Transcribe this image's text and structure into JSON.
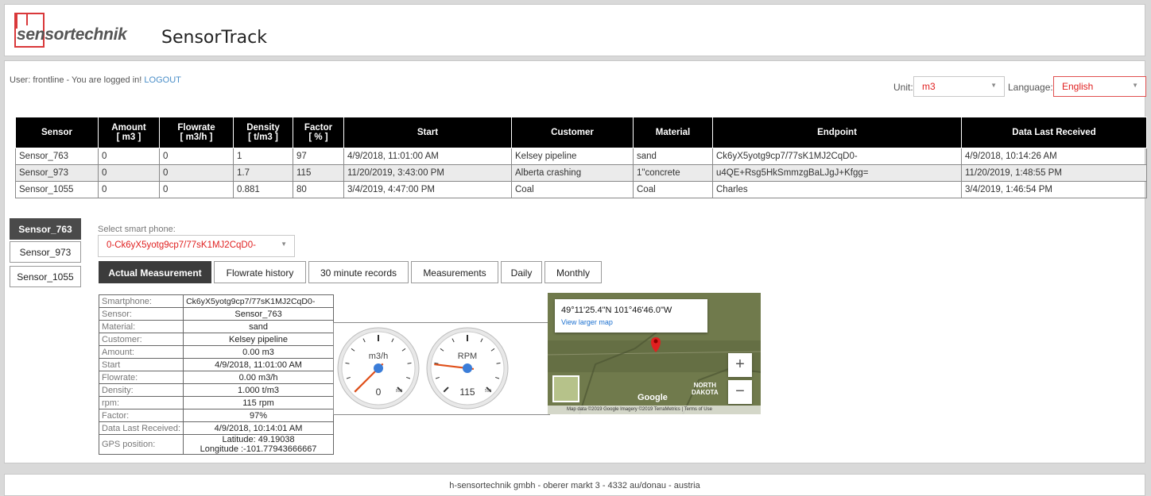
{
  "header": {
    "logo_text": "sensortechnik",
    "app_title": "SensorTrack"
  },
  "userbar": {
    "user_label": "User: frontline",
    "logged_in_text": " - You are logged in! ",
    "logout_label": "LOGOUT",
    "unit_label": "Unit:",
    "unit_value": "m3",
    "language_label": "Language:",
    "language_value": "English"
  },
  "sensor_table": {
    "columns": [
      "Sensor",
      "Amount\n[ m3 ]",
      "Flowrate\n[ m3/h ]",
      "Density\n[ t/m3 ]",
      "Factor\n[ % ]",
      "Start",
      "Customer",
      "Material",
      "Endpoint",
      "Data Last Received"
    ],
    "rows": [
      [
        "Sensor_763",
        "0",
        "0",
        "1",
        "97",
        "4/9/2018, 11:01:00 AM",
        "Kelsey pipeline",
        "sand",
        "Ck6yX5yotg9cp7/77sK1MJ2CqD0-",
        "4/9/2018, 10:14:26 AM"
      ],
      [
        "Sensor_973",
        "0",
        "0",
        "1.7",
        "115",
        "11/20/2019, 3:43:00 PM",
        "Alberta crashing",
        "1\"concrete",
        "u4QE+Rsg5HkSmmzgBaLJgJ+Kfgg=",
        "11/20/2019, 1:48:55 PM"
      ],
      [
        "Sensor_1055",
        "0",
        "0",
        "0.881",
        "80",
        "3/4/2019, 4:47:00 PM",
        "Coal",
        "Coal",
        "Charles",
        "3/4/2019, 1:46:54 PM"
      ]
    ]
  },
  "sensor_list": [
    "Sensor_763",
    "Sensor_973",
    "Sensor_1055"
  ],
  "phone": {
    "label": "Select smart phone:",
    "value": "0-Ck6yX5yotg9cp7/77sK1MJ2CqD0-"
  },
  "view_tabs": [
    "Actual Measurement",
    "Flowrate history",
    "30 minute records",
    "Measurements",
    "Daily",
    "Monthly"
  ],
  "details": [
    [
      "Smartphone:",
      "Ck6yX5yotg9cp7/77sK1MJ2CqD0-"
    ],
    [
      "Sensor:",
      "Sensor_763"
    ],
    [
      "Material:",
      "sand"
    ],
    [
      "Customer:",
      "Kelsey pipeline"
    ],
    [
      "Amount:",
      "0.00 m3"
    ],
    [
      "Start",
      "4/9/2018, 11:01:00 AM"
    ],
    [
      "Flowrate:",
      "0.00 m3/h"
    ],
    [
      "Density:",
      "1.000 t/m3"
    ],
    [
      "rpm:",
      "115 rpm"
    ],
    [
      "Factor:",
      "97%"
    ],
    [
      "Data Last Received:",
      "4/9/2018, 10:14:01 AM"
    ]
  ],
  "gps": {
    "label": "GPS position:",
    "latitude": "Latitude: 49.19038",
    "longitude": "Longitude :-101.77943666667"
  },
  "gauges": [
    {
      "unit": "m3/h",
      "value": 0,
      "max": 1000,
      "mid_tick": "800"
    },
    {
      "unit": "RPM",
      "value": 115,
      "max": 600,
      "mid_tick": "500"
    }
  ],
  "map": {
    "coords": "49°11'25.4\"N 101°46'46.0\"W",
    "link": "View larger map",
    "region_line1": "NORTH",
    "region_line2": "DAKOTA",
    "google": "Google",
    "attribution": "Map data ©2019 Google Imagery ©2019 TerraMetrics  |  Terms of Use",
    "zoom_in": "+",
    "zoom_out": "−"
  },
  "footer": {
    "text": "h-sensortechnik gmbh - oberer markt 3 - 4332 au/donau - austria"
  },
  "colors": {
    "accent_red": "#e02020",
    "logo_red": "#d9383a",
    "link_blue": "#4a8ec8",
    "table_header": "#000000",
    "active_tab": "#3c3c3c"
  }
}
